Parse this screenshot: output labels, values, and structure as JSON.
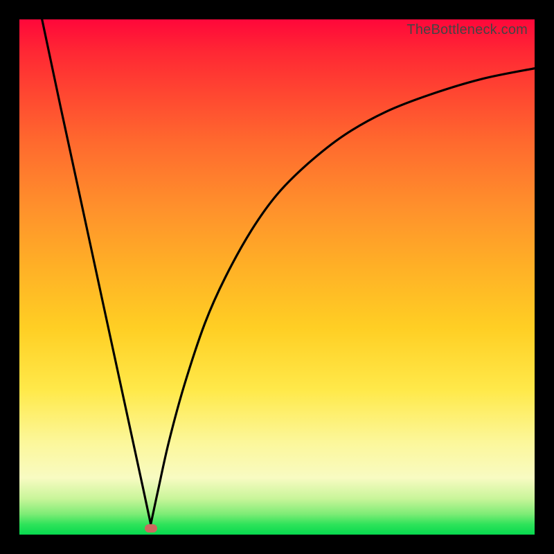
{
  "watermark": "TheBottleneck.com",
  "colors": {
    "frame": "#000000",
    "gradient_top": "#ff073a",
    "gradient_bottom": "#06d94e",
    "curve": "#000000",
    "marker": "#cc6a5f"
  },
  "chart_data": {
    "type": "line",
    "title": "",
    "xlabel": "",
    "ylabel": "",
    "xlim": [
      0,
      100
    ],
    "ylim": [
      0,
      100
    ],
    "grid": false,
    "legend": false,
    "notes": "V-shaped curve; steep linear descent on the left, minimum near x≈25.5, rising concave curve on the right saturating toward the top edge.",
    "series": [
      {
        "name": "left-descent",
        "x": [
          4.4,
          8,
          12,
          16,
          20,
          24,
          25.5
        ],
        "values": [
          100,
          83,
          64.5,
          46,
          27.5,
          9,
          2
        ]
      },
      {
        "name": "right-ascent",
        "x": [
          25.5,
          27,
          29,
          32,
          36,
          40,
          45,
          50,
          56,
          63,
          71,
          80,
          90,
          100
        ],
        "values": [
          2,
          9,
          18,
          29,
          41,
          50,
          59,
          66,
          72,
          77.5,
          82,
          85.5,
          88.5,
          90.5
        ]
      }
    ],
    "marker": {
      "x": 25.5,
      "y": 1.2
    },
    "background_gradient": {
      "direction": "vertical",
      "stops": [
        {
          "pos": 0.0,
          "color": "#ff073a"
        },
        {
          "pos": 0.24,
          "color": "#ff6a2e"
        },
        {
          "pos": 0.48,
          "color": "#ffb026"
        },
        {
          "pos": 0.72,
          "color": "#ffe94a"
        },
        {
          "pos": 0.89,
          "color": "#f8fbc2"
        },
        {
          "pos": 1.0,
          "color": "#06d94e"
        }
      ]
    }
  }
}
